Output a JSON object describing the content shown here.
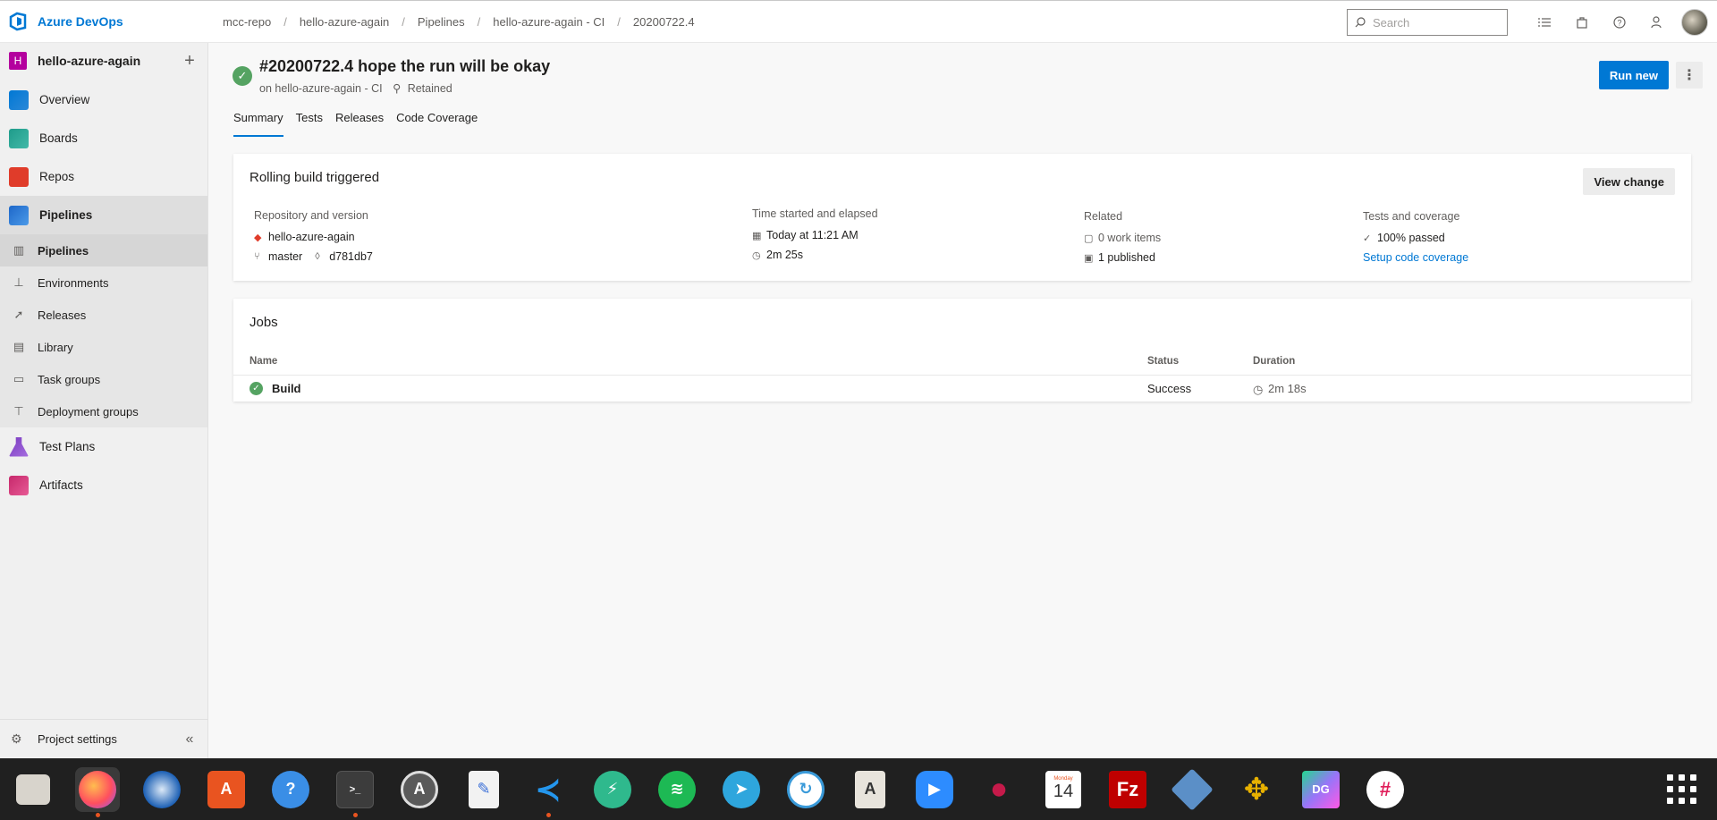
{
  "brand": {
    "name": "Azure DevOps"
  },
  "breadcrumb": [
    "mcc-repo",
    "hello-azure-again",
    "Pipelines",
    "hello-azure-again - CI",
    "20200722.4"
  ],
  "search": {
    "placeholder": "Search"
  },
  "project": {
    "initial": "H",
    "name": "hello-azure-again"
  },
  "nav": {
    "overview": "Overview",
    "boards": "Boards",
    "repos": "Repos",
    "pipelines": "Pipelines",
    "sub": [
      "Pipelines",
      "Environments",
      "Releases",
      "Library",
      "Task groups",
      "Deployment groups"
    ],
    "test_plans": "Test Plans",
    "artifacts": "Artifacts",
    "project_settings": "Project settings"
  },
  "run": {
    "title": "#20200722.4 hope the run will be okay",
    "on": "on hello-azure-again - CI",
    "retained": "Retained",
    "run_new": "Run new"
  },
  "tabs": [
    "Summary",
    "Tests",
    "Releases",
    "Code Coverage"
  ],
  "summary": {
    "title": "Rolling build triggered",
    "view_change": "View change",
    "repo_header": "Repository and version",
    "repo_name": "hello-azure-again",
    "branch": "master",
    "commit": "d781db7",
    "time_header": "Time started and elapsed",
    "started": "Today at 11:21 AM",
    "elapsed": "2m 25s",
    "related_header": "Related",
    "work_items": "0 work items",
    "published": "1 published",
    "tests_header": "Tests and coverage",
    "passed": "100% passed",
    "setup_coverage": "Setup code coverage"
  },
  "jobs": {
    "title": "Jobs",
    "columns": [
      "Name",
      "Status",
      "Duration"
    ],
    "rows": [
      {
        "name": "Build",
        "status": "Success",
        "duration": "2m 18s"
      }
    ]
  },
  "dock": {
    "calendar": {
      "day_name": "Monday",
      "day": "14"
    }
  },
  "colors": {
    "accent": "#0078d4",
    "success": "#55a362",
    "project_badge": "#b4009e"
  }
}
